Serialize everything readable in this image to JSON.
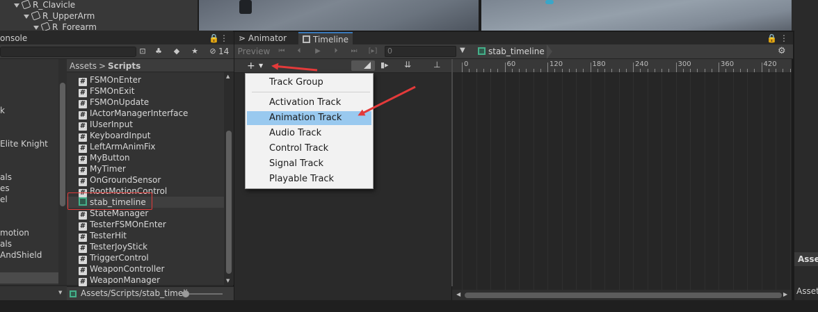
{
  "hierarchy": {
    "rows": [
      "R_Clavicle",
      "R_UpperArm",
      "R_Forearm"
    ]
  },
  "console_tab": {
    "label": "onsole"
  },
  "project_toolbar": {
    "hidden_count": "14"
  },
  "folder_pane": {
    "items": [
      "k",
      "Elite Knight",
      "als",
      "es",
      "el",
      "motion",
      "als",
      "AndShield"
    ]
  },
  "breadcrumb": {
    "root": "Assets",
    "separator": ">",
    "current": "Scripts"
  },
  "files": [
    {
      "name": "FSMOnEnter",
      "icon": "hash"
    },
    {
      "name": "FSMOnExit",
      "icon": "hash"
    },
    {
      "name": "FSMOnUpdate",
      "icon": "hash"
    },
    {
      "name": "IActorManagerInterface",
      "icon": "hash"
    },
    {
      "name": "IUserInput",
      "icon": "hash"
    },
    {
      "name": "KeyboardInput",
      "icon": "hash"
    },
    {
      "name": "LeftArmAnimFix",
      "icon": "hash"
    },
    {
      "name": "MyButton",
      "icon": "hash"
    },
    {
      "name": "MyTimer",
      "icon": "hash"
    },
    {
      "name": "OnGroundSensor",
      "icon": "hash"
    },
    {
      "name": "RootMotionControl",
      "icon": "hash"
    },
    {
      "name": "stab_timeline",
      "icon": "timeline"
    },
    {
      "name": "StateManager",
      "icon": "hash"
    },
    {
      "name": "TesterFSMOnEnter",
      "icon": "hash"
    },
    {
      "name": "TesterHit",
      "icon": "hash"
    },
    {
      "name": "TesterJoyStick",
      "icon": "hash"
    },
    {
      "name": "TriggerControl",
      "icon": "hash"
    },
    {
      "name": "WeaponController",
      "icon": "hash"
    },
    {
      "name": "WeaponManager",
      "icon": "hash"
    }
  ],
  "status_path": "Assets/Scripts/stab_timeli",
  "timeline_tabs": {
    "animator": "Animator",
    "timeline": "Timeline"
  },
  "timeline_toolbar": {
    "preview": "Preview",
    "frame": "0",
    "asset": "stab_timeline"
  },
  "ruler": {
    "labels": [
      "0",
      "60",
      "120",
      "180",
      "240",
      "300",
      "360",
      "420"
    ]
  },
  "add_menu": {
    "items": [
      "Track Group",
      "Activation Track",
      "Animation Track",
      "Audio Track",
      "Control Track",
      "Signal Track",
      "Playable Track"
    ],
    "selected": "Animation Track"
  },
  "inspector": {
    "header": "Asse",
    "text": "Asset"
  },
  "colors": {
    "accent": "#3a79bb",
    "selection": "#99c9ef",
    "annotation": "#e33a3a"
  }
}
